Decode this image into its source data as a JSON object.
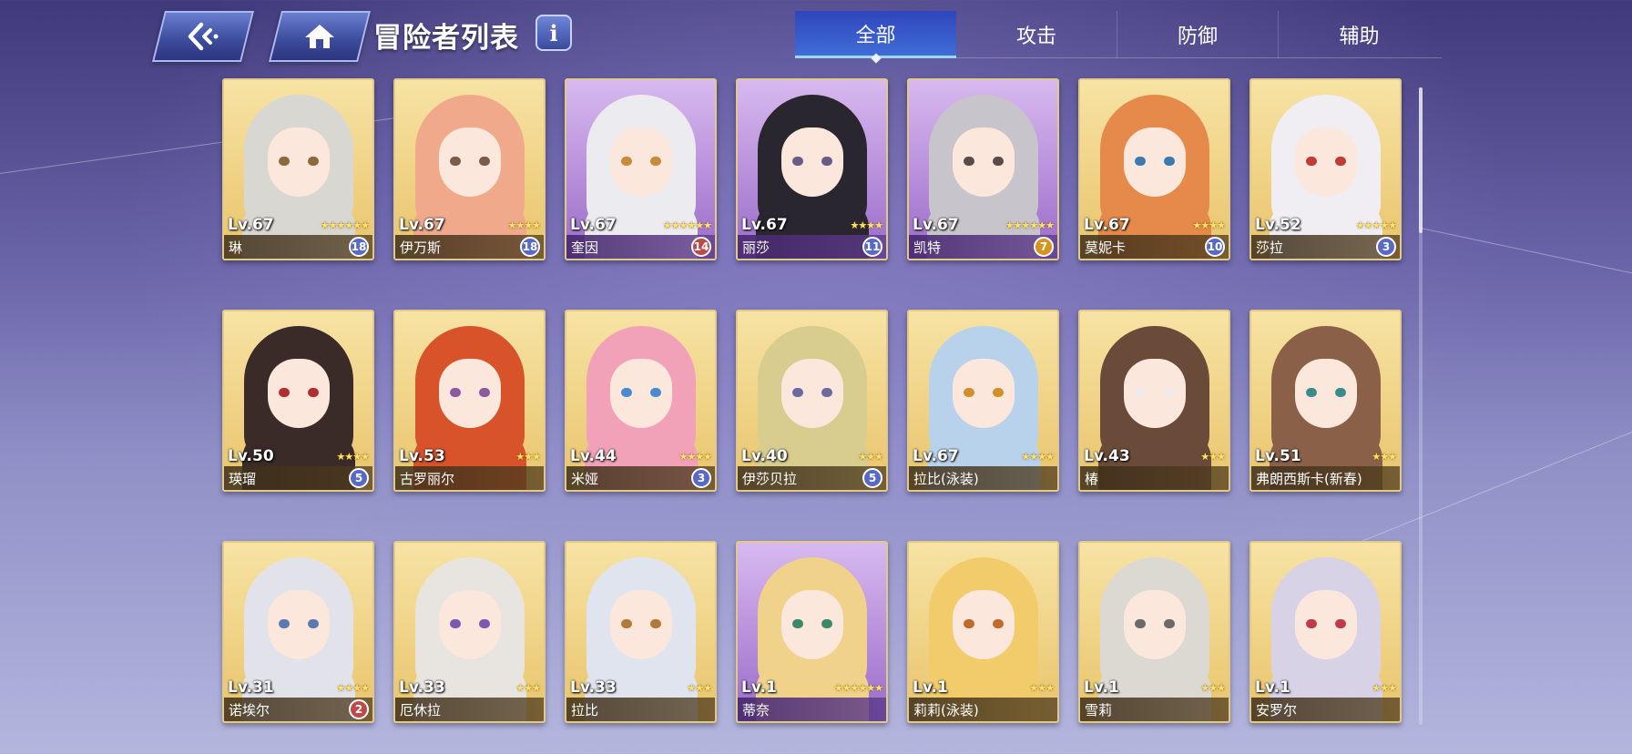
{
  "header": {
    "back_icon": "back-arrow-icon",
    "home_icon": "home-icon",
    "title": "冒险者列表",
    "info_label": "i"
  },
  "tabs": [
    {
      "label": "全部",
      "active": true
    },
    {
      "label": "攻击",
      "active": false
    },
    {
      "label": "防御",
      "active": false
    },
    {
      "label": "辅助",
      "active": false
    }
  ],
  "cards": [
    {
      "level": "Lv.67",
      "name": "琳",
      "stars": 6,
      "badge": "18",
      "badge_color": "blue",
      "frame": "gold",
      "hair": "#d9d7d2",
      "eye": "#8b6a3e"
    },
    {
      "level": "Lv.67",
      "name": "伊万斯",
      "stars": 4,
      "badge": "18",
      "badge_color": "blue",
      "frame": "gold",
      "hair": "#f0a98a",
      "eye": "#7b5b4a"
    },
    {
      "level": "Lv.67",
      "name": "奎因",
      "stars": 6,
      "badge": "14",
      "badge_color": "red",
      "frame": "purple",
      "hair": "#ecebf0",
      "eye": "#c98a3a"
    },
    {
      "level": "Lv.67",
      "name": "丽莎",
      "stars": 4,
      "badge": "11",
      "badge_color": "blue",
      "frame": "purple",
      "hair": "#2a2630",
      "eye": "#6a5a8a"
    },
    {
      "level": "Lv.67",
      "name": "凯特",
      "stars": 6,
      "badge": "7",
      "badge_color": "orange",
      "frame": "purple",
      "hair": "#c8c4cc",
      "eye": "#5a4a4a"
    },
    {
      "level": "Lv.67",
      "name": "莫妮卡",
      "stars": 4,
      "badge": "10",
      "badge_color": "blue",
      "frame": "gold",
      "hair": "#e58a4a",
      "eye": "#3a7ab0"
    },
    {
      "level": "Lv.52",
      "name": "莎拉",
      "stars": 5,
      "badge": "3",
      "badge_color": "blue",
      "frame": "gold",
      "hair": "#f0eef2",
      "eye": "#c03a3a"
    },
    {
      "level": "Lv.50",
      "name": "瑛瑠",
      "stars": 4,
      "badge": "5",
      "badge_color": "blue",
      "frame": "gold",
      "hair": "#3a2a28",
      "eye": "#b03030"
    },
    {
      "level": "Lv.53",
      "name": "古罗丽尔",
      "stars": 3,
      "badge": "",
      "badge_color": "none",
      "frame": "gold",
      "hair": "#d8522a",
      "eye": "#8a5aa0"
    },
    {
      "level": "Lv.44",
      "name": "米娅",
      "stars": 4,
      "badge": "3",
      "badge_color": "blue",
      "frame": "gold",
      "hair": "#f2a2b8",
      "eye": "#4a8ad0"
    },
    {
      "level": "Lv.40",
      "name": "伊莎贝拉",
      "stars": 3,
      "badge": "5",
      "badge_color": "blue",
      "frame": "gold",
      "hair": "#d8cc8e",
      "eye": "#6a6aa0"
    },
    {
      "level": "Lv.67",
      "name": "拉比(泳装)",
      "stars": 4,
      "badge": "",
      "badge_color": "none",
      "frame": "gold",
      "hair": "#b8d2ec",
      "eye": "#d0902a"
    },
    {
      "level": "Lv.43",
      "name": "椿",
      "stars": 3,
      "badge": "",
      "badge_color": "none",
      "frame": "gold",
      "hair": "#6a4a38",
      "eye": "#ececec"
    },
    {
      "level": "Lv.51",
      "name": "弗朗西斯卡(新春)",
      "stars": 3,
      "badge": "",
      "badge_color": "none",
      "frame": "gold",
      "hair": "#8a6048",
      "eye": "#3a8a8a"
    },
    {
      "level": "Lv.31",
      "name": "诺埃尔",
      "stars": 4,
      "badge": "2",
      "badge_color": "red",
      "frame": "gold",
      "hair": "#e2e2ea",
      "eye": "#5a7ab0"
    },
    {
      "level": "Lv.33",
      "name": "厄休拉",
      "stars": 3,
      "badge": "",
      "badge_color": "none",
      "frame": "gold",
      "hair": "#e8e4e0",
      "eye": "#7a5ab0"
    },
    {
      "level": "Lv.33",
      "name": "拉比",
      "stars": 3,
      "badge": "",
      "badge_color": "none",
      "frame": "gold",
      "hair": "#dfe4ee",
      "eye": "#b07a3a"
    },
    {
      "level": "Lv.1",
      "name": "蒂奈",
      "stars": 6,
      "badge": "",
      "badge_color": "none",
      "frame": "purple",
      "hair": "#f0d28a",
      "eye": "#3a8a6a"
    },
    {
      "level": "Lv.1",
      "name": "莉莉(泳装)",
      "stars": 3,
      "badge": "",
      "badge_color": "none",
      "frame": "gold",
      "hair": "#f2cc6a",
      "eye": "#c06a2a"
    },
    {
      "level": "Lv.1",
      "name": "雪莉",
      "stars": 3,
      "badge": "",
      "badge_color": "none",
      "frame": "gold",
      "hair": "#dcd8d2",
      "eye": "#6a6a6a"
    },
    {
      "level": "Lv.1",
      "name": "安罗尔",
      "stars": 3,
      "badge": "",
      "badge_color": "none",
      "frame": "gold",
      "hair": "#d8d2e6",
      "eye": "#c03a4a"
    }
  ],
  "scroll": {
    "position_fraction": 0.0
  }
}
